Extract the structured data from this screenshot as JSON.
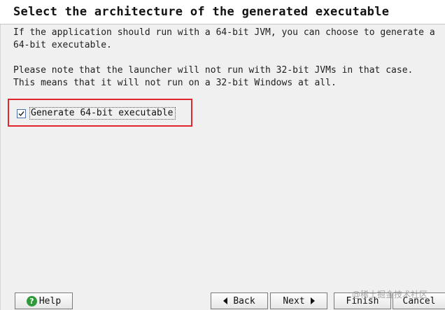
{
  "header": {
    "title": "Select the architecture of the generated executable"
  },
  "main": {
    "description_1": "If the application should run with a 64-bit JVM, you can choose to generate a\n64-bit executable.",
    "description_2": "Please note that the launcher will not run with 32-bit JVMs in that case.\nThis means that it will not run on a 32-bit Windows at all.",
    "checkbox": {
      "label": "Generate 64-bit executable",
      "checked": true
    },
    "highlight_color": "#e0262a"
  },
  "footer": {
    "help_label": "Help",
    "back_label": "Back",
    "next_label": "Next",
    "finish_label": "Finish",
    "cancel_label": "Cancel",
    "watermark": "@稀土掘金技术社区"
  },
  "icons": {
    "help": "help-icon",
    "back": "arrow-left-icon",
    "next": "arrow-right-icon",
    "checkbox": "checkmark-icon"
  }
}
